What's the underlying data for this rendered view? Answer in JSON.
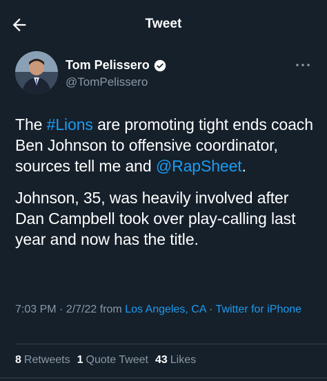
{
  "header": {
    "title": "Tweet",
    "back_icon": "arrow-left-icon"
  },
  "author": {
    "name": "Tom Pelissero",
    "handle": "@TomPelissero",
    "verified_icon": "verified-badge-icon",
    "more_icon": "more-dots-icon"
  },
  "tweet": {
    "p1_part1": "The ",
    "p1_hashtag": "#Lions",
    "p1_part2": " are promoting tight ends coach Ben Johnson to offensive coordinator, sources tell me and ",
    "p1_mention": "@RapSheet",
    "p1_part3": ".",
    "p2": "Johnson, 35, was heavily involved after Dan Campbell took over play-calling last year and now has the title."
  },
  "meta": {
    "time": "7:03 PM",
    "sep1": " · ",
    "date": "2/7/22",
    "from": " from ",
    "location": "Los Angeles, CA",
    "sep2": " · ",
    "client": "Twitter for iPhone"
  },
  "stats": {
    "retweets_count": "8",
    "retweets_label": "Retweets",
    "quotes_count": "1",
    "quotes_label": "Quote Tweet",
    "likes_count": "43",
    "likes_label": "Likes"
  },
  "colors": {
    "background": "#15202b",
    "accent": "#1d9bf0",
    "secondary_text": "#8b98a5"
  }
}
